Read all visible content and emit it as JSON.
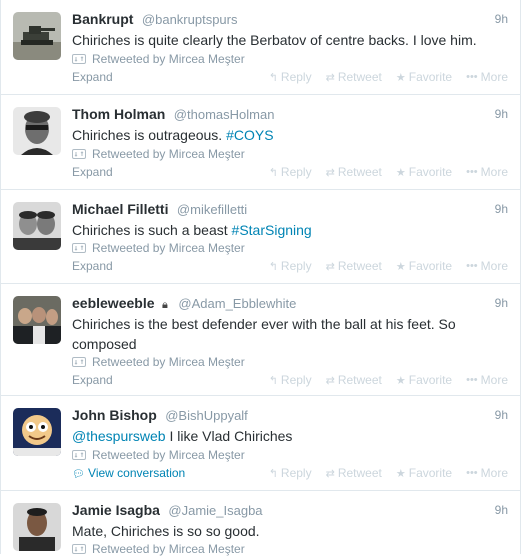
{
  "tweets": [
    {
      "name": "Bankrupt",
      "handle": "@bankruptspurs",
      "time": "9h",
      "text_parts": [
        {
          "text": "Chiriches is quite clearly the Berbatov of centre backs. I love him.",
          "link": false
        }
      ],
      "retweeted_by": "Retweeted by Mircea Meşter",
      "footer": "Expand",
      "footer_type": "expand",
      "avatar": "tank-photo"
    },
    {
      "name": "Thom Holman",
      "handle": "@thomasHolman",
      "time": "9h",
      "text_parts": [
        {
          "text": "Chiriches is outrageous. ",
          "link": false
        },
        {
          "text": "#COYS",
          "link": true
        }
      ],
      "retweeted_by": "Retweeted by Mircea Meşter",
      "footer": "Expand",
      "footer_type": "expand",
      "avatar": "man-bw-photo"
    },
    {
      "name": "Michael Filletti",
      "handle": "@mikefilletti",
      "time": "9h",
      "text_parts": [
        {
          "text": "Chiriches is such a beast ",
          "link": false
        },
        {
          "text": "#StarSigning",
          "link": true
        }
      ],
      "retweeted_by": "Retweeted by Mircea Meşter",
      "footer": "Expand",
      "footer_type": "expand",
      "avatar": "two-men-photo"
    },
    {
      "name": "eebleweeble",
      "handle": "@Adam_Ebblewhite",
      "time": "9h",
      "text_parts": [
        {
          "text": "Chiriches is the best defender ever with the ball at his feet. So composed",
          "link": false
        }
      ],
      "retweeted_by": "Retweeted by Mircea Meşter",
      "footer": "Expand",
      "footer_type": "expand",
      "avatar": "group-photo"
    },
    {
      "name": "John Bishop",
      "handle": "@BishUppyalf",
      "time": "9h",
      "text_parts": [
        {
          "text": "@thespursweb",
          "link": true
        },
        {
          "text": " I like Vlad Chiriches",
          "link": false
        }
      ],
      "retweeted_by": "Retweeted by Mircea Meşter",
      "footer": "View conversation",
      "footer_type": "conversation",
      "avatar": "cartoon-photo"
    },
    {
      "name": "Jamie Isagba",
      "handle": "@Jamie_Isagba",
      "time": "9h",
      "text_parts": [
        {
          "text": "Mate, Chiriches is so so good.",
          "link": false
        }
      ],
      "retweeted_by": "Retweeted by Mircea Meşter",
      "footer": "",
      "footer_type": "none",
      "avatar": "young-man-photo"
    }
  ],
  "actions": {
    "reply": "Reply",
    "retweet": "Retweet",
    "favorite": "Favorite",
    "more": "More"
  },
  "colors": {
    "link": "#0084b4",
    "muted": "#8899a6",
    "action": "#ccd6dd"
  }
}
